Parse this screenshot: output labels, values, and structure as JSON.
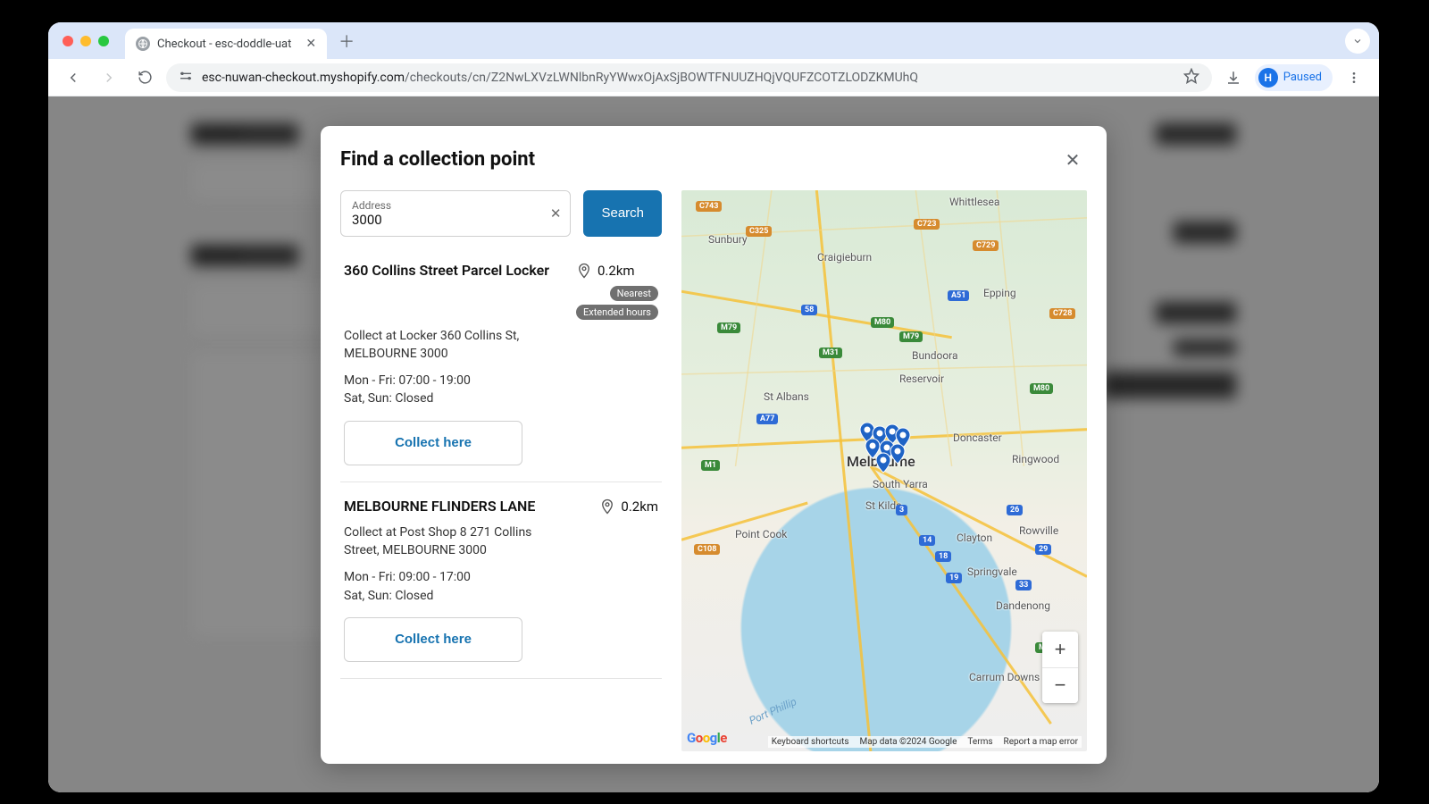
{
  "browser": {
    "tab_title": "Checkout - esc-doddle-uat",
    "url_host": "esc-nuwan-checkout.myshopify.com",
    "url_path": "/checkouts/cn/Z2NwLXVzLWNlbnRyYWwxOjAxSjBOWTFNUUZHQjVQUFZCOTZLODZKMUhQ",
    "profile_initial": "H",
    "profile_status": "Paused"
  },
  "backdrop": {
    "contact_heading": "Contact",
    "delivery_heading": "Delivery"
  },
  "modal": {
    "title": "Find a collection point",
    "search": {
      "label": "Address",
      "value": "3000",
      "button": "Search"
    },
    "results": [
      {
        "name": "360 Collins Street Parcel Locker",
        "distance": "0.2km",
        "tags": [
          "Nearest",
          "Extended hours"
        ],
        "address": "Collect at Locker 360 Collins St, MELBOURNE 3000",
        "hours_weekday": "Mon - Fri: 07:00 - 19:00",
        "hours_weekend": "Sat, Sun: Closed",
        "cta": "Collect here"
      },
      {
        "name": "MELBOURNE FLINDERS LANE",
        "distance": "0.2km",
        "tags": [],
        "address": "Collect at Post Shop 8 271 Collins Street, MELBOURNE 3000",
        "hours_weekday": "Mon - Fri: 09:00 - 17:00",
        "hours_weekend": "Sat, Sun: Closed",
        "cta": "Collect here"
      }
    ]
  },
  "map": {
    "labels": {
      "whittlesea": "Whittlesea",
      "bundoora": "Bundoora",
      "reservoir": "Reservoir",
      "epping": "Epping",
      "craigieburn": "Craigieburn",
      "sunbury": "Sunbury",
      "stalbans": "St Albans",
      "melbourne": "Melbourne",
      "doncaster": "Doncaster",
      "ringwood": "Ringwood",
      "southyarra": "South Yarra",
      "stkilda": "St Kilda",
      "clayton": "Clayton",
      "rowville": "Rowville",
      "springvale": "Springvale",
      "dandenong": "Dandenong",
      "pointcook": "Point Cook",
      "carrummowns": "Carrum Downs",
      "bay": "Port Phillip"
    },
    "shields": {
      "c743": "C743",
      "c325": "C325",
      "c723": "C723",
      "c729": "C729",
      "c728": "C728",
      "m79a": "M79",
      "m79b": "M79",
      "m80a": "M80",
      "m80b": "M80",
      "a51": "A51",
      "m31": "M31",
      "a77": "A77",
      "n58": "58",
      "m1": "M1",
      "c108": "C108",
      "n3": "3",
      "n14": "14",
      "n18": "18",
      "n19": "19",
      "n29": "29",
      "n33": "33",
      "n26": "26",
      "m420": "M420"
    },
    "footer": {
      "shortcuts": "Keyboard shortcuts",
      "data": "Map data ©2024 Google",
      "terms": "Terms",
      "report": "Report a map error"
    }
  }
}
